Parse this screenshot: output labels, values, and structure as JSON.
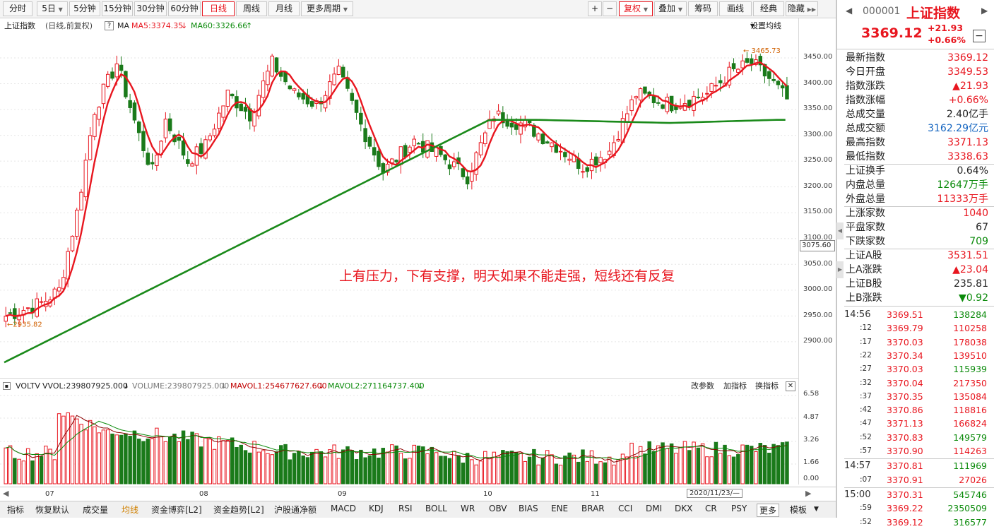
{
  "toolbar": {
    "left": [
      "分时",
      "5日",
      "5分钟",
      "15分钟",
      "30分钟",
      "60分钟",
      "日线",
      "周线",
      "月线",
      "更多周期"
    ],
    "right": [
      "+",
      "−",
      "复权",
      "叠加",
      "筹码",
      "画线",
      "经典",
      "隐藏"
    ]
  },
  "info": {
    "name": "上证指数",
    "mode": "(日线,前复权)",
    "help": "?",
    "ma": "MA",
    "ma5": "MA5:3374.35",
    "ma60": "MA60:3326.66",
    "setting": "设置均线"
  },
  "price_axis": {
    "ticks": [
      "3450.00",
      "3400.00",
      "3350.00",
      "3300.00",
      "3250.00",
      "3200.00",
      "3150.00",
      "3100.00",
      "3050.00",
      "3000.00",
      "2950.00",
      "2900.00"
    ],
    "current": "3075.60",
    "vol_ticks": [
      "6.58",
      "4.87",
      "3.26",
      "1.66",
      "0.00"
    ]
  },
  "marks": {
    "high": "3465.73",
    "low": "2935.82"
  },
  "annotation": "上有压力，下有支撑，明天如果不能走强，短线还有反复",
  "volume": {
    "label": "VOLTV",
    "vvol": "VVOL:239807925.000",
    "volume": "VOLUME:239807925.000",
    "mavol1": "MAVOL1:254677627.600",
    "mavol2": "MAVOL2:271164737.400",
    "actions": [
      "改参数",
      "加指标",
      "换指标"
    ]
  },
  "xaxis": {
    "months": [
      "07",
      "08",
      "09",
      "10",
      "11"
    ],
    "cursor": "2020/11/23/—"
  },
  "bottom": [
    "指标",
    "恢复默认",
    "成交量",
    "均线",
    "资金博弈[L2]",
    "资金趋势[L2]",
    "沪股通净额",
    "MACD",
    "KDJ",
    "RSI",
    "BOLL",
    "WR",
    "OBV",
    "BIAS",
    "ENE",
    "BRAR",
    "CCI",
    "DMI",
    "DKX",
    "CR",
    "PSY",
    "更多",
    "模板"
  ],
  "quote": {
    "code": "000001",
    "name": "上证指数",
    "price": "3369.12",
    "change": "+21.93",
    "pct": "+0.66%"
  },
  "stats": [
    {
      "k": "最新指数",
      "v": "3369.12",
      "c": "red"
    },
    {
      "k": "今日开盘",
      "v": "3349.53",
      "c": "red"
    },
    {
      "k": "指数涨跌",
      "v": "▲21.93",
      "c": "red"
    },
    {
      "k": "指数涨幅",
      "v": "+0.66%",
      "c": "red"
    },
    {
      "k": "总成交量",
      "v": "2.40亿手",
      "c": ""
    },
    {
      "k": "总成交额",
      "v": "3162.29亿元",
      "c": "blue"
    },
    {
      "k": "最高指数",
      "v": "3371.13",
      "c": "red"
    },
    {
      "k": "最低指数",
      "v": "3338.63",
      "c": "red"
    },
    {
      "k": "上证换手",
      "v": "0.64%",
      "c": ""
    },
    {
      "k": "内盘总量",
      "v": "12647万手",
      "c": "green"
    },
    {
      "k": "外盘总量",
      "v": "11333万手",
      "c": "red"
    },
    {
      "k": "上涨家数",
      "v": "1040",
      "c": "red"
    },
    {
      "k": "平盘家数",
      "v": "67",
      "c": ""
    },
    {
      "k": "下跌家数",
      "v": "709",
      "c": "green"
    },
    {
      "k": "上证A股",
      "v": "3531.51",
      "c": "red"
    },
    {
      "k": "上A涨跌",
      "v": "▲23.04",
      "c": "red"
    },
    {
      "k": "上证B股",
      "v": "235.81",
      "c": ""
    },
    {
      "k": "上B涨跌",
      "v": "▼0.92",
      "c": "green"
    }
  ],
  "ticks": [
    {
      "t": "14:56",
      "p": "3369.51",
      "v": "138284",
      "vc": "green"
    },
    {
      "t": ":12",
      "p": "3369.79",
      "v": "110258",
      "vc": "red"
    },
    {
      "t": ":17",
      "p": "3370.03",
      "v": "178038",
      "vc": "red"
    },
    {
      "t": ":22",
      "p": "3370.34",
      "v": "139510",
      "vc": "red"
    },
    {
      "t": ":27",
      "p": "3370.03",
      "v": "115939",
      "vc": "green"
    },
    {
      "t": ":32",
      "p": "3370.04",
      "v": "217350",
      "vc": "red"
    },
    {
      "t": ":37",
      "p": "3370.35",
      "v": "135084",
      "vc": "red"
    },
    {
      "t": ":42",
      "p": "3370.86",
      "v": "118816",
      "vc": "red"
    },
    {
      "t": ":47",
      "p": "3371.13",
      "v": "166824",
      "vc": "red"
    },
    {
      "t": ":52",
      "p": "3370.83",
      "v": "149579",
      "vc": "green"
    },
    {
      "t": ":57",
      "p": "3370.90",
      "v": "114263",
      "vc": "red"
    },
    {
      "t": "14:57",
      "p": "3370.81",
      "v": "111969",
      "vc": "green"
    },
    {
      "t": ":07",
      "p": "3370.91",
      "v": "27026",
      "vc": "red"
    },
    {
      "t": "15:00",
      "p": "3370.31",
      "v": "545746",
      "vc": "green"
    },
    {
      "t": ":59",
      "p": "3369.22",
      "v": "2350509",
      "vc": "green"
    },
    {
      "t": ":52",
      "p": "3369.12",
      "v": "316577",
      "vc": "green"
    }
  ]
}
